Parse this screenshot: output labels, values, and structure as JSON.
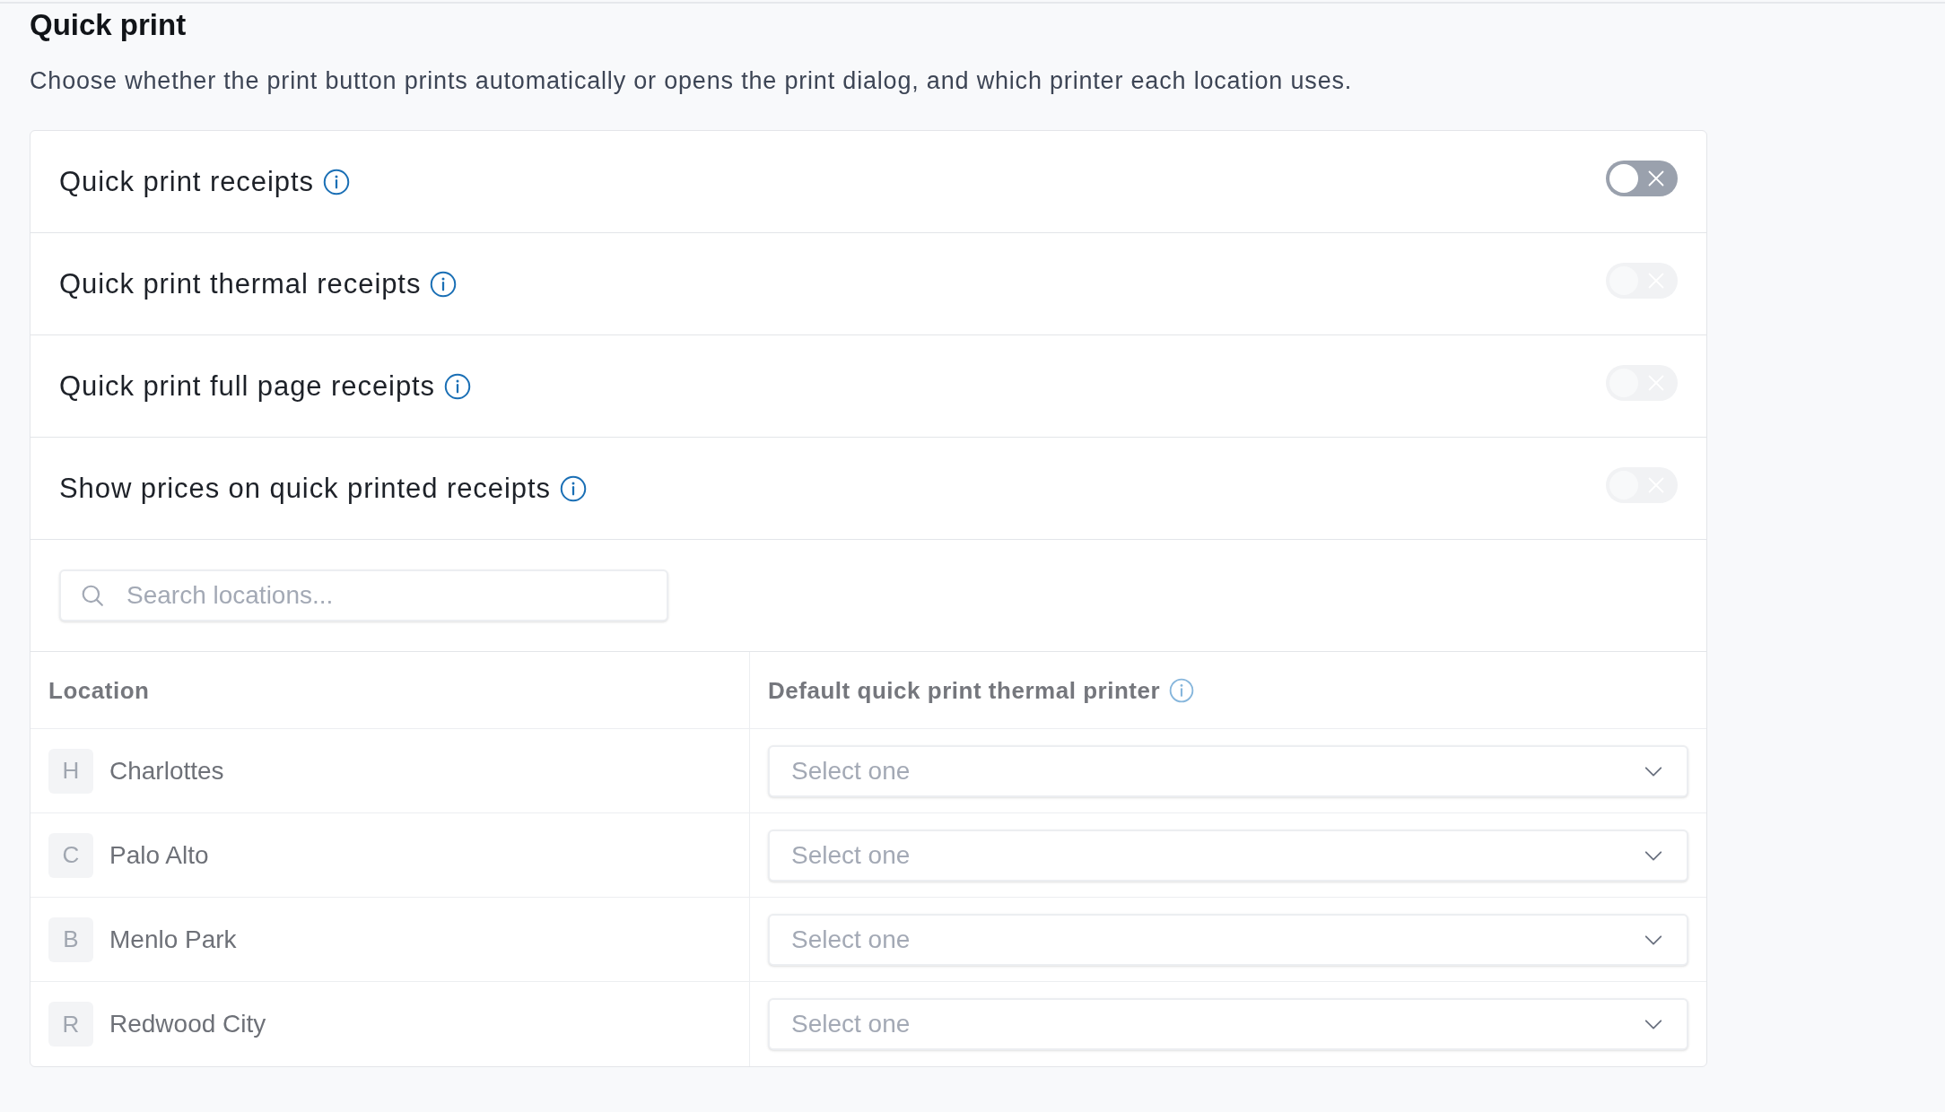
{
  "section": {
    "title": "Quick print",
    "description": "Choose whether the print button prints automatically or opens the print dialog, and which printer each location uses."
  },
  "settings": [
    {
      "label": "Quick print receipts",
      "on": false,
      "disabled": false
    },
    {
      "label": "Quick print thermal receipts",
      "on": false,
      "disabled": true
    },
    {
      "label": "Quick print full page receipts",
      "on": false,
      "disabled": true
    },
    {
      "label": "Show prices on quick printed receipts",
      "on": false,
      "disabled": true
    }
  ],
  "search": {
    "placeholder": "Search locations..."
  },
  "table": {
    "columns": [
      {
        "label": "Location",
        "info": false
      },
      {
        "label": "Default quick print thermal printer",
        "info": true
      }
    ],
    "rows": [
      {
        "initial": "H",
        "location": "Charlottes",
        "printer": {
          "placeholder": "Select one"
        }
      },
      {
        "initial": "C",
        "location": "Palo Alto",
        "printer": {
          "placeholder": "Select one"
        }
      },
      {
        "initial": "B",
        "location": "Menlo Park",
        "printer": {
          "placeholder": "Select one"
        }
      },
      {
        "initial": "R",
        "location": "Redwood City",
        "printer": {
          "placeholder": "Select one"
        }
      }
    ]
  }
}
